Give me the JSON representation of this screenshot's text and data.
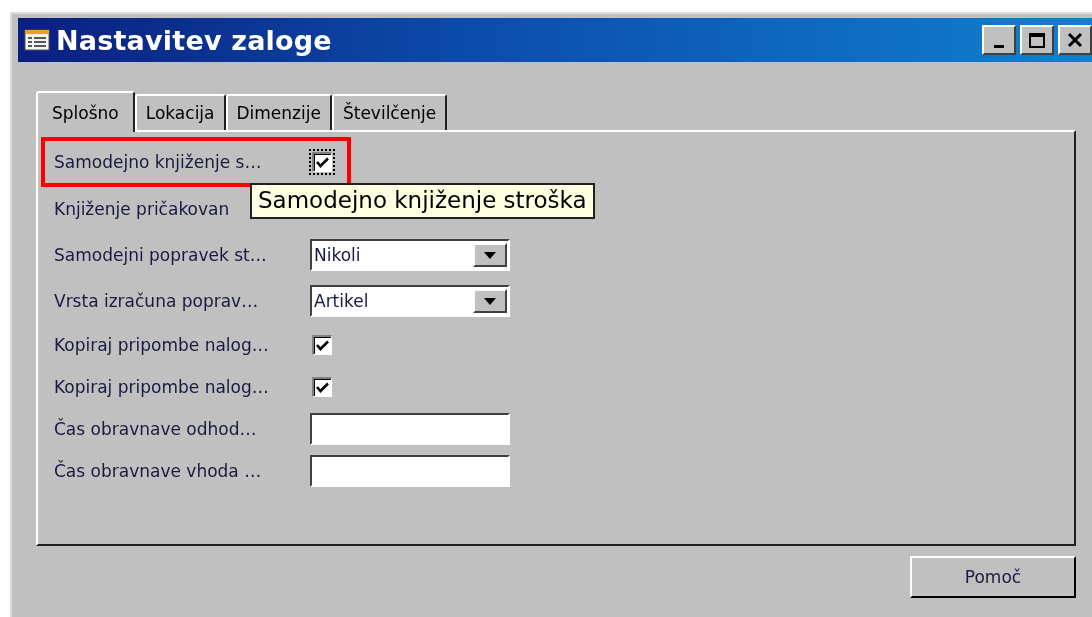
{
  "window": {
    "title": "Nastavitev zaloge",
    "controls": [
      {
        "kind": "minimize"
      },
      {
        "kind": "maximize"
      },
      {
        "kind": "close"
      }
    ]
  },
  "tabs": [
    {
      "label": "Splošno",
      "selected": true
    },
    {
      "label": "Lokacija",
      "selected": false
    },
    {
      "label": "Dimenzije",
      "selected": false
    },
    {
      "label": "Številčenje",
      "selected": false
    }
  ],
  "fields": [
    {
      "kind": "checkbox",
      "label": "Samodejno knjiženje s…",
      "checked": true,
      "focused": true,
      "highlighted": true
    },
    {
      "kind": "hidden",
      "label": "Knjiženje pričakovan"
    },
    {
      "kind": "dropdown",
      "label": "Samodejni popravek st…",
      "value": "Nikoli"
    },
    {
      "kind": "dropdown",
      "label": "Vrsta izračuna poprav…",
      "value": "Artikel"
    },
    {
      "kind": "checkbox",
      "label": "Kopiraj pripombe nalog…",
      "checked": true
    },
    {
      "kind": "checkbox",
      "label": "Kopiraj pripombe nalog…",
      "checked": true
    },
    {
      "kind": "textbox",
      "label": "Čas obravnave odhod…"
    },
    {
      "kind": "textbox",
      "label": "Čas obravnave vhoda …"
    }
  ],
  "tooltip": {
    "text": "Samodejno knjiženje stroška"
  },
  "buttons": [
    {
      "label": "Pomoč"
    }
  ]
}
